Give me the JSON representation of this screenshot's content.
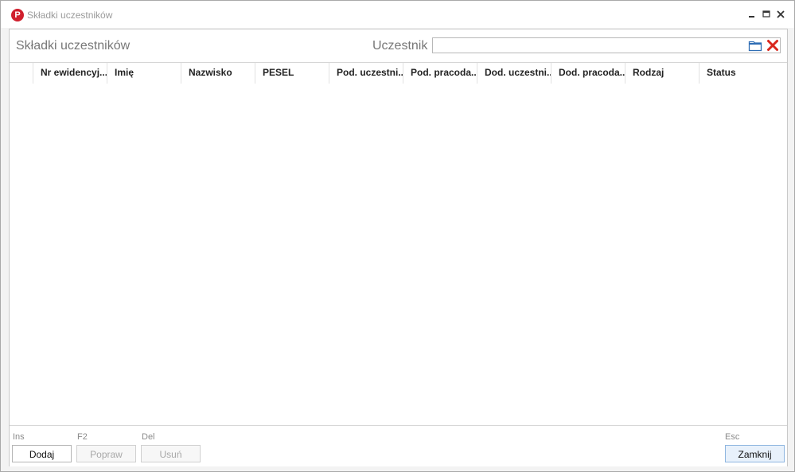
{
  "window": {
    "title": "Składki uczestników",
    "logo_letter": "P"
  },
  "panel": {
    "title": "Składki uczestników"
  },
  "filter": {
    "label": "Uczestnik",
    "value": ""
  },
  "columns": [
    "Nr ewidencyj...",
    "Imię",
    "Nazwisko",
    "PESEL",
    "Pod. uczestni...",
    "Pod. pracoda...",
    "Dod. uczestni...",
    "Dod. pracoda...",
    "Rodzaj",
    "Status"
  ],
  "footer": {
    "add": {
      "hotkey": "Ins",
      "label": "Dodaj"
    },
    "edit": {
      "hotkey": "F2",
      "label": "Popraw"
    },
    "delete": {
      "hotkey": "Del",
      "label": "Usuń"
    },
    "close": {
      "hotkey": "Esc",
      "label": "Zamknij"
    }
  },
  "colors": {
    "accent": "#d0202e",
    "clear_icon": "#d9261c",
    "folder_icon": "#2e6db4"
  }
}
